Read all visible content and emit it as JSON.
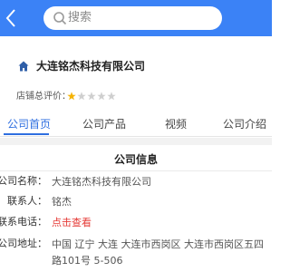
{
  "search": {
    "placeholder": "搜索"
  },
  "company": {
    "name": "大连铭杰科技有限公司"
  },
  "rating": {
    "label": "店铺总评价：",
    "stars": 1,
    "max_stars": 5
  },
  "tabs": [
    {
      "label": "公司首页",
      "active": true
    },
    {
      "label": "公司产品",
      "active": false
    },
    {
      "label": "视频",
      "active": false
    },
    {
      "label": "公司介绍",
      "active": false
    }
  ],
  "info": {
    "title": "公司信息",
    "rows": [
      {
        "label": "公司名称：",
        "value": "大连铭杰科技有限公司"
      },
      {
        "label": "联系人：",
        "value": "铭杰"
      },
      {
        "label": "联系电话：",
        "value": "点击查看"
      },
      {
        "label": "公司地址：",
        "value": "中国 辽宁 大连 大连市西岗区 大连市西岗区五四路101号 5-506"
      }
    ]
  },
  "colors": {
    "header": "#3b82f6",
    "accent": "#2f6fe0",
    "link": "#e53935",
    "star_on": "#f5b301",
    "star_off": "#cfcfcf"
  }
}
